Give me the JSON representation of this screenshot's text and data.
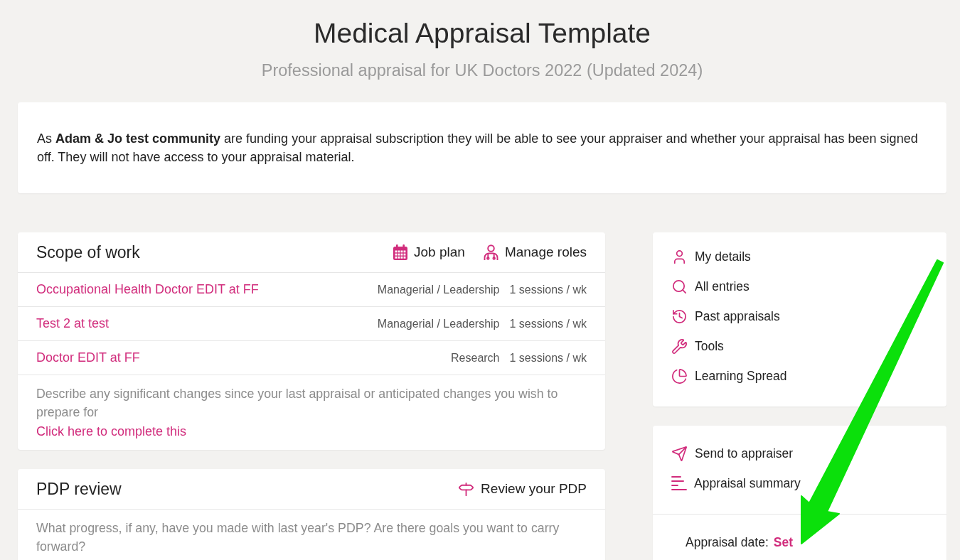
{
  "header": {
    "title": "Medical Appraisal Template",
    "subtitle": "Professional appraisal for UK Doctors 2022 (Updated 2024)"
  },
  "notice": {
    "text": "As **Adam & Jo test community** are funding your appraisal subscription they will be able to see your appraiser and whether your appraisal has been signed off. They will not have access to your appraisal material."
  },
  "scope_of_work": {
    "title": "Scope of work",
    "actions": [
      {
        "label": "Job plan"
      },
      {
        "label": "Manage roles"
      }
    ],
    "rows": [
      {
        "role": "Occupational Health Doctor EDIT at FF",
        "category": "Managerial / Leadership",
        "sessions": "1 sessions / wk"
      },
      {
        "role": "Test 2 at test",
        "category": "Managerial / Leadership",
        "sessions": "1 sessions / wk"
      },
      {
        "role": "Doctor EDIT at FF",
        "category": "Research",
        "sessions": "1 sessions / wk"
      }
    ],
    "prompt": "Describe any significant changes since your last appraisal or anticipated changes you wish to prepare for",
    "link": "Click here to complete this"
  },
  "pdp_review": {
    "title": "PDP review",
    "action": {
      "label": "Review your PDP"
    },
    "prompt": "What progress, if any, have you made with last year's PDP? Are there goals you want to carry forward?"
  },
  "navigation": {
    "items": [
      "My details",
      "All entries",
      "Past appraisals",
      "Tools",
      "Learning Spread"
    ]
  },
  "submission": {
    "items": [
      "Send to appraiser",
      "Appraisal summary"
    ],
    "appraisal_date": {
      "label": "Appraisal date:",
      "value": "Set"
    }
  }
}
